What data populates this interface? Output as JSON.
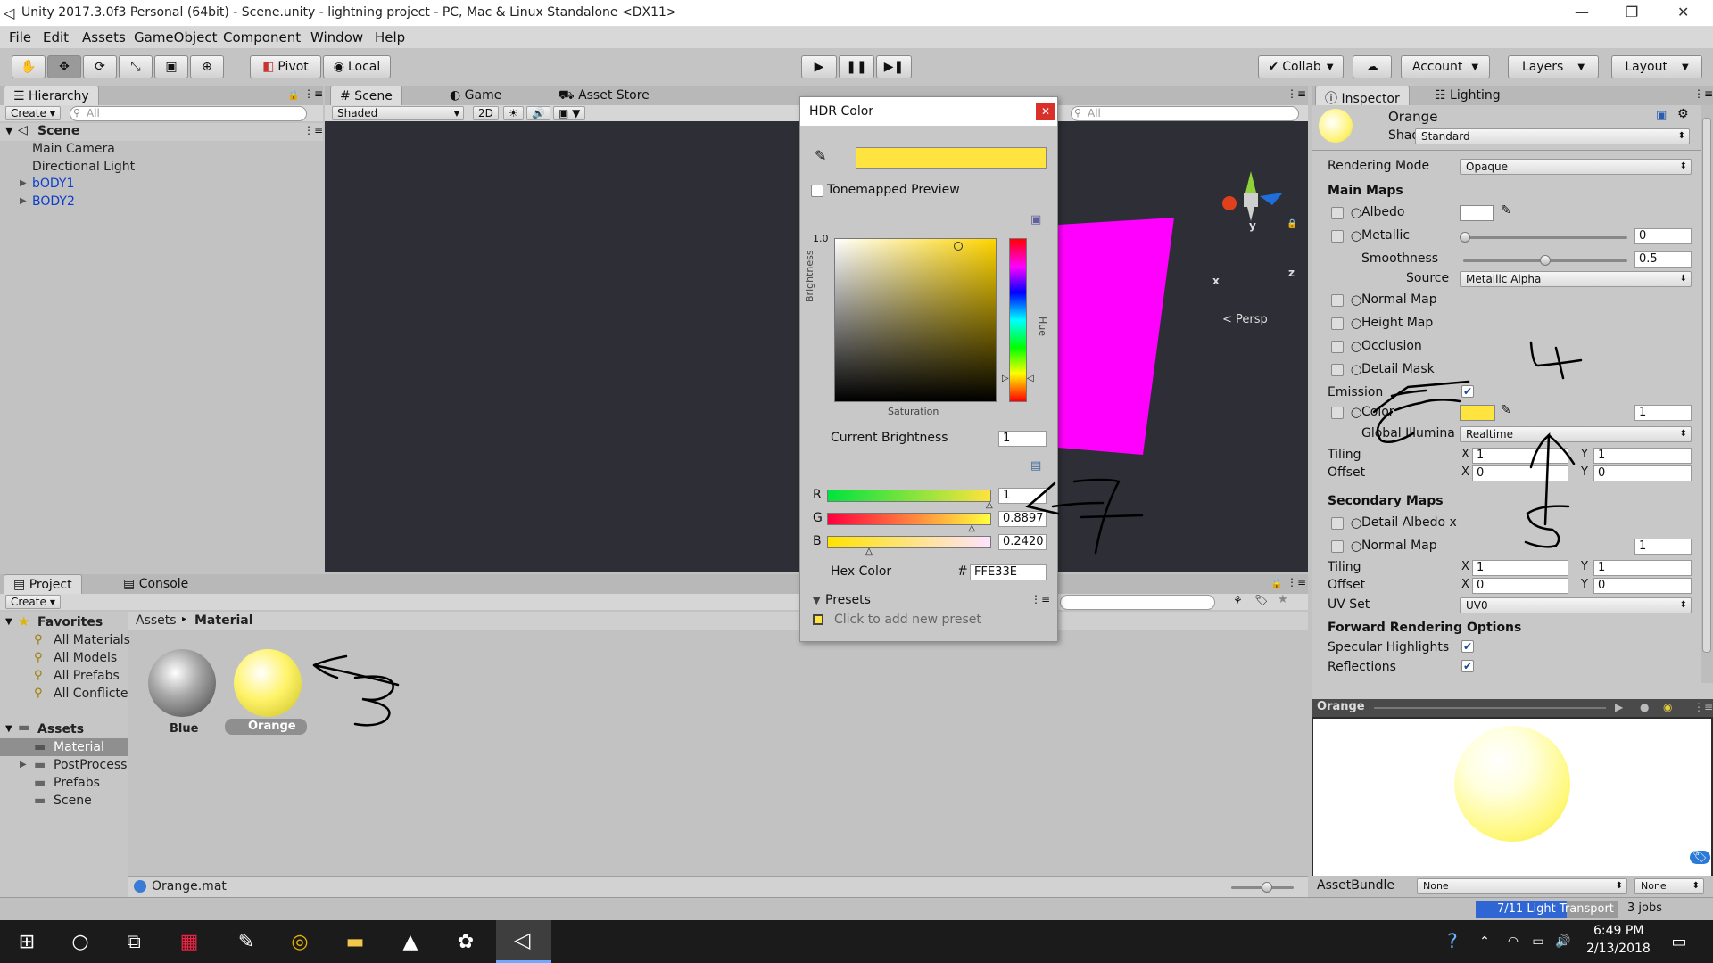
{
  "window": {
    "title": "Unity 2017.3.0f3 Personal (64bit) - Scene.unity - lightning project - PC, Mac & Linux Standalone <DX11>"
  },
  "menu": [
    "File",
    "Edit",
    "Assets",
    "GameObject",
    "Component",
    "Window",
    "Help"
  ],
  "toolbar": {
    "pivot": "Pivot",
    "local": "Local",
    "collab": "Collab",
    "account": "Account",
    "layers": "Layers",
    "layout": "Layout"
  },
  "hierarchy": {
    "tab": "Hierarchy",
    "create": "Create",
    "search": "All",
    "scene": "Scene",
    "items": [
      "Main Camera",
      "Directional Light",
      "bODY1",
      "BODY2"
    ]
  },
  "scene_view": {
    "tabs": [
      "Scene",
      "Game",
      "Asset Store"
    ],
    "shading": "Shaded",
    "mode2d": "2D",
    "search": "All",
    "persp": "Persp",
    "axes": [
      "y",
      "x",
      "z"
    ]
  },
  "hdr_dialog": {
    "title": "HDR Color",
    "tonemapped": "Tonemapped Preview",
    "brightness_axis": "Brightness",
    "hue_axis": "Hue",
    "saturation_axis": "Saturation",
    "top_value": "1.0",
    "current_brightness_label": "Current Brightness",
    "current_brightness": "1",
    "channels": [
      {
        "name": "R",
        "value": "1",
        "fraction": 1.0
      },
      {
        "name": "G",
        "value": "0.8897",
        "fraction": 0.8897
      },
      {
        "name": "B",
        "value": "0.2420",
        "fraction": 0.242
      }
    ],
    "hex_label": "Hex Color",
    "hex_hash": "#",
    "hex_value": "FFE33E",
    "presets": "Presets",
    "add_preset": "Click to add new preset",
    "swatch_color": "#FFE33E"
  },
  "project": {
    "tabs": [
      "Project",
      "Console"
    ],
    "create": "Create",
    "favorites_label": "Favorites",
    "favorites": [
      "All Materials",
      "All Models",
      "All Prefabs",
      "All Conflicte"
    ],
    "assets_label": "Assets",
    "folders": [
      "Material",
      "PostProcess",
      "Prefabs",
      "Scene"
    ],
    "breadcrumb": [
      "Assets",
      "Material"
    ],
    "assets": [
      "Blue",
      "Orange"
    ],
    "status_file": "Orange.mat"
  },
  "inspector": {
    "tabs": [
      "Inspector",
      "Lighting"
    ],
    "name": "Orange",
    "shader_label": "Shader",
    "shader": "Standard",
    "rendering_mode_label": "Rendering Mode",
    "rendering_mode": "Opaque",
    "main_maps": "Main Maps",
    "albedo": "Albedo",
    "metallic": "Metallic",
    "metallic_value": "0",
    "smoothness": "Smoothness",
    "smoothness_value": "0.5",
    "source_label": "Source",
    "source": "Metallic Alpha",
    "normal_map": "Normal Map",
    "height_map": "Height Map",
    "occlusion": "Occlusion",
    "detail_mask": "Detail Mask",
    "emission": "Emission",
    "color": "Color",
    "emission_intensity": "1",
    "global_illum": "Global Illumina",
    "global_illum_value": "Realtime",
    "tiling": "Tiling",
    "offset": "Offset",
    "x": "X",
    "y": "Y",
    "tiling_x": "1",
    "tiling_y": "1",
    "offset_x": "0",
    "offset_y": "0",
    "secondary_maps": "Secondary Maps",
    "detail_albedo": "Detail Albedo x",
    "normal_map2": "Normal Map",
    "normal_map2_value": "1",
    "tiling2_x": "1",
    "tiling2_y": "1",
    "offset2_x": "0",
    "offset2_y": "0",
    "uv_set": "UV Set",
    "uv_set_value": "UV0",
    "forward_opts": "Forward Rendering Options",
    "specular": "Specular Highlights",
    "reflections": "Reflections",
    "preview_title": "Orange",
    "assetbundle": "AssetBundle",
    "ab_none": "None",
    "ab_none2": "None",
    "emission_color": "#FFE33E"
  },
  "status": {
    "progress": "7/11 Light Transport",
    "jobs": "3 jobs",
    "progress_fraction": 0.64
  },
  "taskbar": {
    "time": "6:49 PM",
    "date": "2/13/2018"
  },
  "annotations": [
    "4",
    "3",
    "7",
    "5"
  ]
}
